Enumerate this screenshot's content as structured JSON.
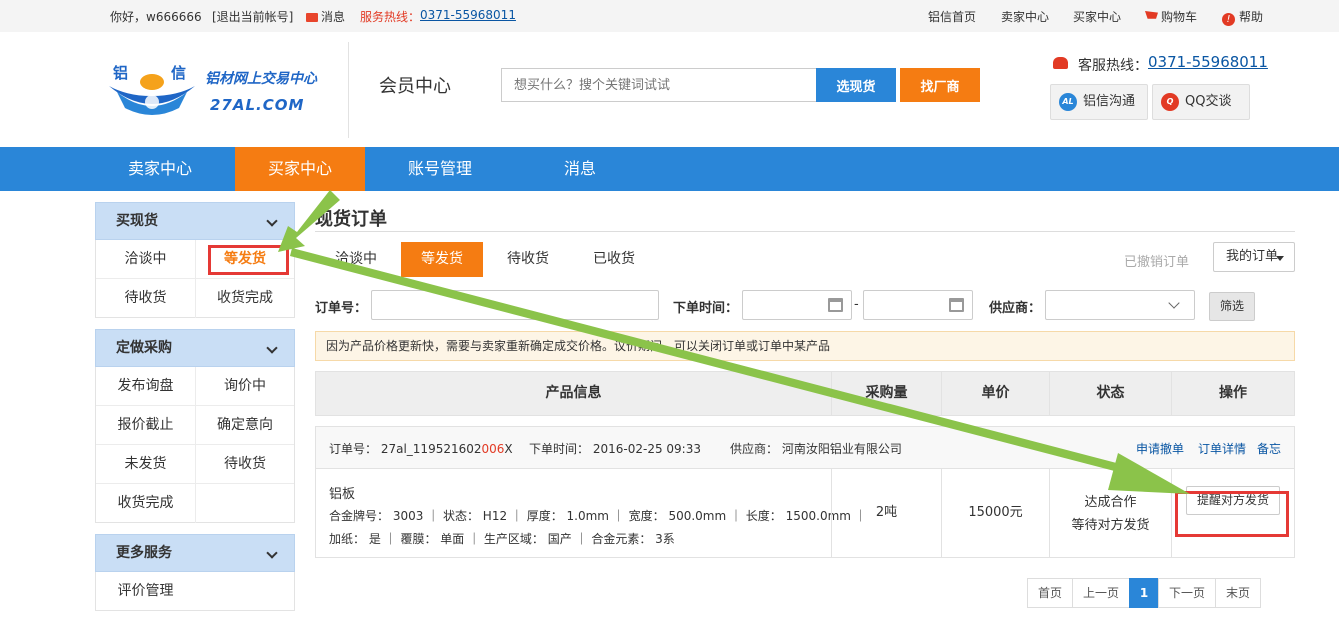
{
  "topbar": {
    "greeting": "你好，w666666",
    "logout": "[退出当前帐号]",
    "messages": "消息",
    "service_label": "服务热线：",
    "service_phone": "0371-55968011",
    "links": [
      "铝信首页",
      "卖家中心",
      "买家中心"
    ],
    "cart": "购物车",
    "help": "帮助"
  },
  "header": {
    "logo_chars": [
      "铝",
      "信"
    ],
    "slogan": "铝材网上交易中心",
    "domain": "27AL.COM",
    "member_center": "会员中心",
    "search_placeholder": "想买什么？搜个关键词试试",
    "btn_goods": "选现货",
    "btn_factory": "找厂商",
    "hotline_label": "客服热线：",
    "hotline_number": "0371-55968011",
    "chat_lx": "铝信沟通",
    "chat_lx_icon": "AL",
    "chat_qq": "QQ交谈",
    "chat_qq_icon": "Q"
  },
  "nav": [
    "卖家中心",
    "买家中心",
    "账号管理",
    "消息"
  ],
  "sidebar": {
    "sec1": {
      "title": "买现货",
      "items": [
        "洽谈中",
        "等发货",
        "待收货",
        "收货完成"
      ]
    },
    "sec2": {
      "title": "定做采购",
      "items": [
        "发布询盘",
        "询价中",
        "报价截止",
        "确定意向",
        "未发货",
        "待收货",
        "收货完成"
      ]
    },
    "sec3": {
      "title": "更多服务",
      "items": [
        "评价管理"
      ]
    }
  },
  "main": {
    "title": "现货订单",
    "tabs": [
      "洽谈中",
      "等发货",
      "待收货",
      "已收货"
    ],
    "revoked": "已撤销订单",
    "my_orders": "我的订单",
    "filters": {
      "order_no": "订单号：",
      "order_time": "下单时间：",
      "dash": "-",
      "supplier": "供应商：",
      "btn": "筛选"
    },
    "notice": "因为产品价格更新快，需要与卖家重新确定成交价格。议价期间，可以关闭订单或订单中某产品",
    "columns": [
      "产品信息",
      "采购量",
      "单价",
      "状态",
      "操作"
    ],
    "order": {
      "no_label": "订单号：",
      "no_prefix": "27al_119521602",
      "no_red": "006",
      "no_suffix": "X",
      "time_label": "下单时间：",
      "time": "2016-02-25 09:33",
      "supplier_label": "供应商：",
      "supplier": "河南汝阳铝业有限公司",
      "actions": [
        "申请撤单",
        "订单详情",
        "备忘"
      ],
      "product": "铝板",
      "spec1": "合金牌号： 3003 ｜ 状态： H12 ｜ 厚度： 1.0mm ｜ 宽度： 500.0mm ｜ 长度： 1500.0mm ｜",
      "spec2": "加纸： 是 ｜ 覆膜： 单面 ｜ 生产区域： 国产 ｜ 合金元素： 3系",
      "qty": "2吨",
      "price": "15000元",
      "status1": "达成合作",
      "status2": "等待对方发货",
      "btn": "提醒对方发货"
    },
    "pager": [
      "首页",
      "上一页",
      "1",
      "下一页",
      "末页"
    ]
  },
  "colors": {
    "nav_blue": "#2a86d8",
    "accent_orange": "#f57c12",
    "annotation_red": "#e53935",
    "arrow_green": "#8bc34a"
  }
}
